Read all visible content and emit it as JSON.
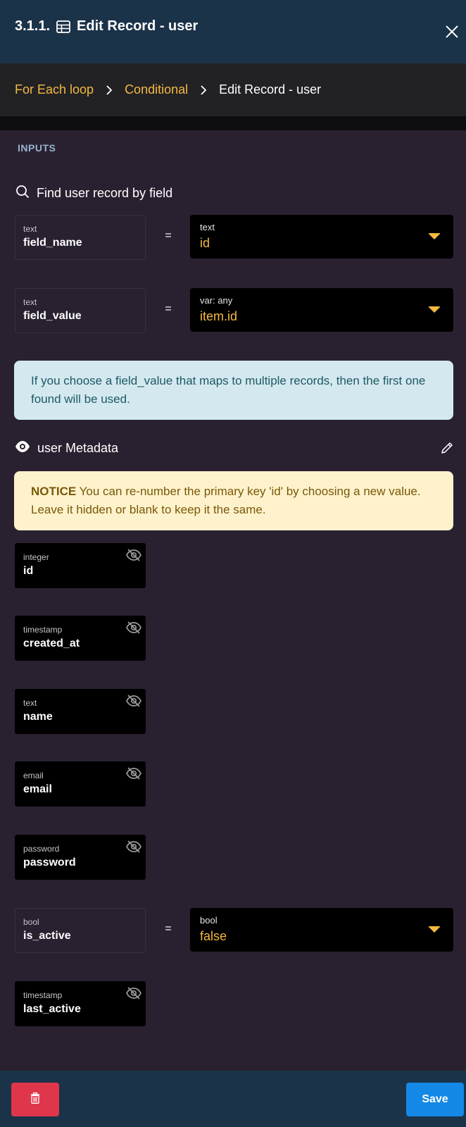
{
  "header": {
    "step": "3.1.1.",
    "title": "Edit Record - user",
    "icons": {
      "table": "table-icon",
      "close": "close-icon"
    }
  },
  "breadcrumb": {
    "items": [
      "For Each loop",
      "Conditional"
    ],
    "current": "Edit Record - user"
  },
  "inputs": {
    "section_label": "INPUTS",
    "find_label": "Find user record by field",
    "field_name": {
      "type": "text",
      "name": "field_name",
      "eq": "=",
      "value_type": "text",
      "value": "id"
    },
    "field_value": {
      "type": "text",
      "name": "field_value",
      "eq": "=",
      "value_type": "var: any",
      "value": "item.id"
    },
    "info": "If you choose a field_value that maps to multiple records, then the first one found will be used."
  },
  "metadata": {
    "label": "user Metadata",
    "notice_title": "NOTICE",
    "notice_text": " You can re-number the primary key 'id' by choosing a new value. Leave it hidden or blank to keep it the same.",
    "fields": [
      {
        "type": "integer",
        "name": "id"
      },
      {
        "type": "timestamp",
        "name": "created_at"
      },
      {
        "type": "text",
        "name": "name"
      },
      {
        "type": "email",
        "name": "email"
      },
      {
        "type": "password",
        "name": "password"
      },
      {
        "type": "bool",
        "name": "is_active",
        "eq": "=",
        "value_type": "bool",
        "value": "false"
      },
      {
        "type": "timestamp",
        "name": "last_active"
      }
    ]
  },
  "footer": {
    "save_label": "Save",
    "icons": {
      "delete": "trash-icon"
    }
  },
  "colors": {
    "accent": "#f5b93e",
    "header_bg": "#1b3349",
    "body_bg": "#2a2130",
    "save": "#1488e6",
    "delete": "#e0364b",
    "info_bg": "#d3e9ef",
    "notice_bg": "#fef2cc"
  }
}
